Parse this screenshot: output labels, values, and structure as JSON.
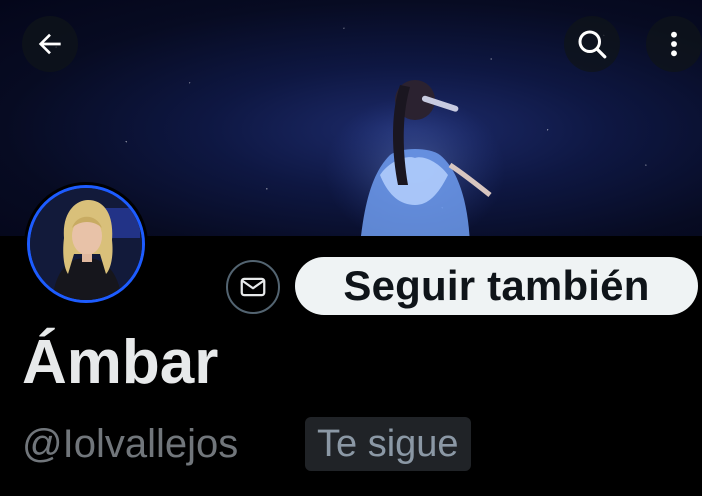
{
  "header": {
    "back_icon": "arrow-left-icon",
    "search_icon": "search-icon",
    "more_icon": "more-vertical-icon"
  },
  "banner": {
    "image": "concert-singer-banner"
  },
  "profile": {
    "avatar": "profile-avatar",
    "message_icon": "envelope-icon",
    "follow_button_label": "Seguir también",
    "name": "Ámbar",
    "handle": "@Iolvallejos",
    "follows_you_badge": "Te sigue"
  },
  "colors": {
    "background": "#000000",
    "avatar_ring": "#1d5cff",
    "follow_button_bg": "#eff3f4",
    "handle_text": "#71767b",
    "badge_bg": "#202327"
  }
}
